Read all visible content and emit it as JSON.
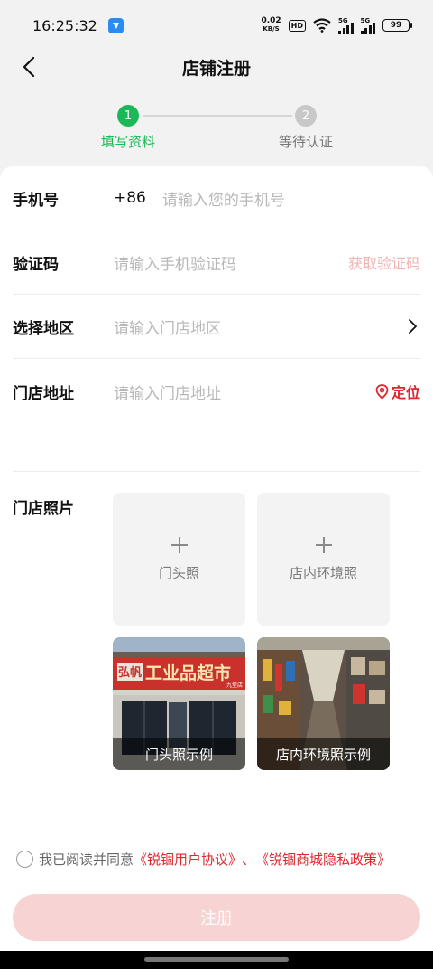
{
  "status_bar": {
    "time": "16:25:32",
    "net_speed_value": "0.02",
    "net_speed_unit": "KB/S",
    "hd_label": "HD",
    "signal1_label": "5G",
    "signal2_label": "5G",
    "battery": "99"
  },
  "nav": {
    "title": "店铺注册"
  },
  "stepper": {
    "steps": [
      {
        "number": "1",
        "label": "填写资料",
        "active": true
      },
      {
        "number": "2",
        "label": "等待认证",
        "active": false
      }
    ]
  },
  "form": {
    "phone": {
      "label": "手机号",
      "prefix": "+86",
      "placeholder": "请输入您的手机号"
    },
    "code": {
      "label": "验证码",
      "placeholder": "请输入手机验证码",
      "action": "获取验证码"
    },
    "region": {
      "label": "选择地区",
      "placeholder": "请输入门店地区"
    },
    "address": {
      "label": "门店地址",
      "placeholder": "请输入门店地址",
      "action": "定位"
    },
    "photos": {
      "label": "门店照片",
      "upload_front": "门头照",
      "upload_inside": "店内环境照",
      "example_front": "门头照示例",
      "example_inside": "店内环境照示例",
      "sign_brand": "弘帆",
      "sign_text": "工业品超市",
      "sign_branch": "九堡店"
    }
  },
  "agreement": {
    "prefix": "我已阅读并同意",
    "user_agreement": "《锐锢用户协议》",
    "separator": "、",
    "privacy_policy": "《锐锢商城隐私政策》"
  },
  "register_button": "注册",
  "colors": {
    "accent_green": "#1cb858",
    "accent_red": "#e0262f",
    "disabled_red": "#f8d3d3",
    "muted_red": "#f2b3b3"
  }
}
